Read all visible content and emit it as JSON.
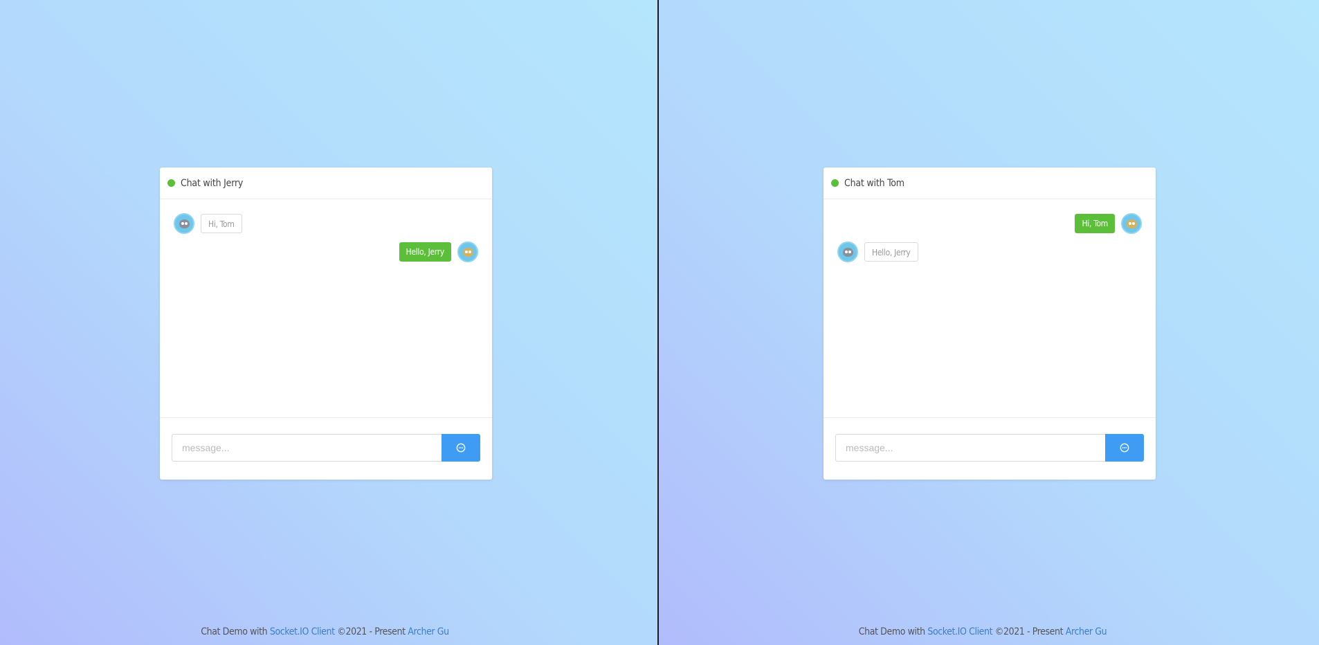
{
  "colors": {
    "online": "#5cbf3a",
    "outgoing_bubble": "#5cbf3a",
    "send_button": "#3f9cf5",
    "link": "#3a7fc8"
  },
  "left": {
    "title": "Chat with Jerry",
    "messages": [
      {
        "direction": "in",
        "avatar": "tom-avatar",
        "text": "Hi, Tom"
      },
      {
        "direction": "out",
        "avatar": "jerry-avatar",
        "text": "Hello, Jerry"
      }
    ],
    "input_placeholder": "message...",
    "send_icon": "chat-bubble-icon"
  },
  "right": {
    "title": "Chat with Tom",
    "messages": [
      {
        "direction": "out",
        "avatar": "jerry-avatar",
        "text": "Hi, Tom"
      },
      {
        "direction": "in",
        "avatar": "tom-avatar",
        "text": "Hello, Jerry"
      }
    ],
    "input_placeholder": "message...",
    "send_icon": "chat-bubble-icon"
  },
  "footer": {
    "prefix": "Chat Demo with",
    "link1": "Socket.IO Client",
    "middle": "©2021 - Present",
    "link2": "Archer Gu"
  }
}
